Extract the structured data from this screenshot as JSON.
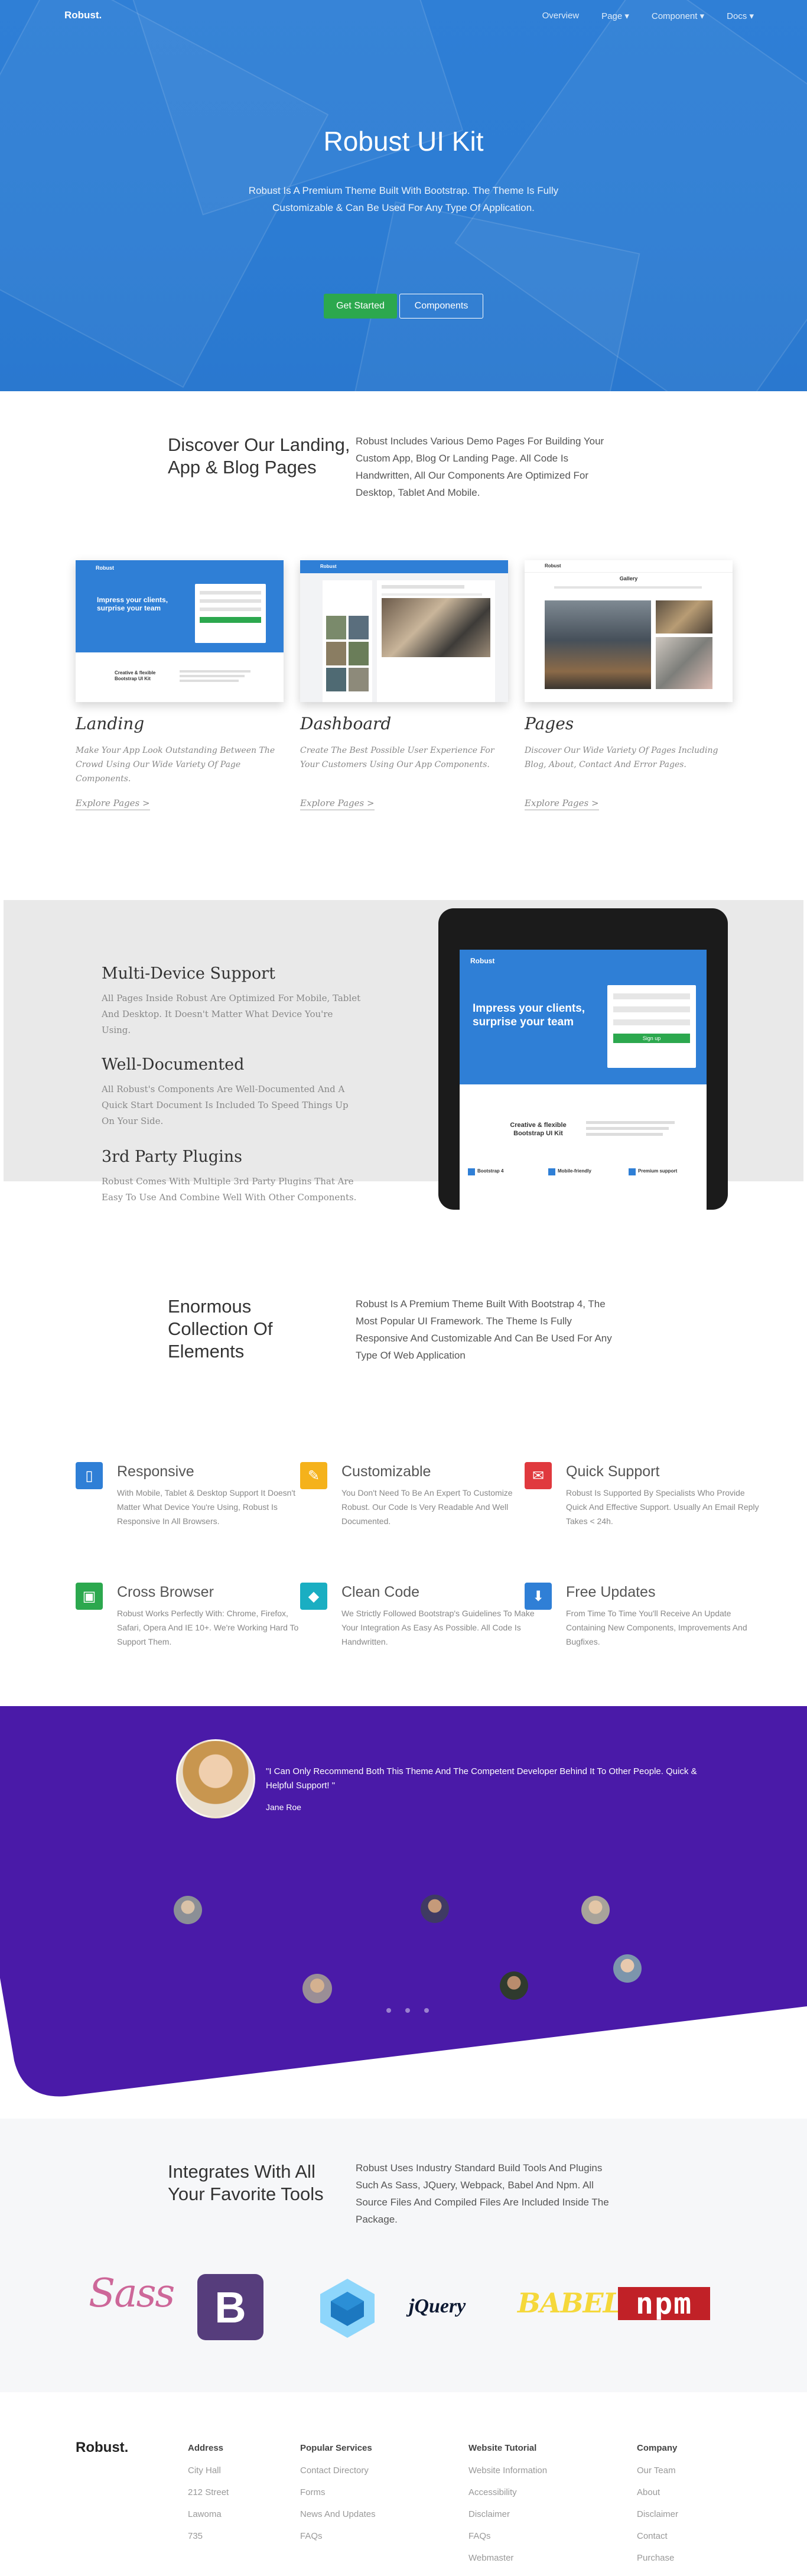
{
  "nav": {
    "brand": "Robust.",
    "links": [
      "Overview",
      "Page ▾",
      "Component ▾",
      "Docs ▾"
    ]
  },
  "hero": {
    "title": "Robust UI Kit",
    "subtitle": "Robust Is A Premium Theme Built With Bootstrap. The Theme Is Fully Customizable & Can Be Used For Any Type Of Application.",
    "primary_button": "Get Started",
    "secondary_button": "Components"
  },
  "discover": {
    "title": "Discover Our Landing, App & Blog Pages",
    "description": "Robust Includes Various Demo Pages For Building Your Custom App, Blog Or Landing Page. All Code Is Handwritten, All Our Components Are Optimized For Desktop, Tablet And Mobile."
  },
  "demos": [
    {
      "title": "Landing",
      "description": "Make Your App Look Outstanding Between The Crowd Using Our Wide Variety Of Page Components.",
      "link": "Explore Pages >",
      "thumb_brand": "Robust",
      "thumb_heading": "Impress your clients, surprise your team",
      "thumb_sub": "Creative & flexible Bootstrap UI Kit"
    },
    {
      "title": "Dashboard",
      "description": "Create The Best Possible User Experience For Your Customers Using Our App Components.",
      "link": "Explore Pages >",
      "thumb_brand": "Robust"
    },
    {
      "title": "Pages",
      "description": "Discover Our Wide Variety Of Pages Including Blog, About, Contact And Error Pages.",
      "link": "Explore Pages >",
      "thumb_brand": "Robust",
      "thumb_heading": "Gallery"
    }
  ],
  "devices": {
    "features": [
      {
        "title": "Multi-Device Support",
        "text": "All Pages Inside Robust Are Optimized For Mobile, Tablet And Desktop. It Doesn't Matter What Device You're Using."
      },
      {
        "title": "Well-Documented",
        "text": "All Robust's Components Are Well-Documented And A Quick Start Document Is Included To Speed Things Up On Your Side."
      },
      {
        "title": "3rd Party Plugins",
        "text": "Robust Comes With Multiple 3rd Party Plugins That Are Easy To Use And Combine Well With Other Components."
      }
    ],
    "tablet": {
      "brand": "Robust",
      "heading": "Impress your clients, surprise your team",
      "subheading": "Creative & flexible Bootstrap UI Kit",
      "signup": "Sign up",
      "items": [
        "Bootstrap 4",
        "Mobile-friendly",
        "Premium support"
      ]
    }
  },
  "elements": {
    "title": "Enormous Collection Of Elements",
    "description": "Robust Is A Premium Theme Built With Bootstrap 4, The Most Popular UI Framework. The Theme Is Fully Responsive And Customizable And Can Be Used For Any Type Of Web Application",
    "items": [
      {
        "icon": "mobile-icon",
        "color": "#2f7fd6",
        "title": "Responsive",
        "text": "With Mobile, Tablet & Desktop Support It Doesn't Matter What Device You're Using, Robust Is Responsive In All Browsers."
      },
      {
        "icon": "brush-icon",
        "color": "#f5b21b",
        "title": "Customizable",
        "text": "You Don't Need To Be An Expert To Customize Robust. Our Code Is Very Readable And Well Documented."
      },
      {
        "icon": "chat-icon",
        "color": "#e0393e",
        "title": "Quick Support",
        "text": "Robust Is Supported By Specialists Who Provide Quick And Effective Support. Usually An Email Reply Takes < 24h."
      },
      {
        "icon": "browser-icon",
        "color": "#2ca84e",
        "title": "Cross Browser",
        "text": "Robust Works Perfectly With: Chrome, Firefox, Safari, Opera And IE 10+. We're Working Hard To Support Them."
      },
      {
        "icon": "diamond-icon",
        "color": "#1aaec2",
        "title": "Clean Code",
        "text": "We Strictly Followed Bootstrap's Guidelines To Make Your Integration As Easy As Possible. All Code Is Handwritten."
      },
      {
        "icon": "download-icon",
        "color": "#2f7fd6",
        "title": "Free Updates",
        "text": "From Time To Time You'll Receive An Update Containing New Components, Improvements And Bugfixes."
      }
    ]
  },
  "testimonial": {
    "quote": "\"I Can Only Recommend Both This Theme And The Competent Developer Behind It To Other People. Quick & Helpful Support! \"",
    "author": "Jane Roe",
    "background": "#4a1aa8"
  },
  "integrations": {
    "title": "Integrates With All Your Favorite Tools",
    "description": "Robust Uses Industry Standard Build Tools And Plugins Such As Sass, JQuery, Webpack, Babel And Npm. All Source Files And Compiled Files Are Included Inside The Package.",
    "logos": {
      "sass": "Sass",
      "bootstrap": "B",
      "jquery": "jQuery",
      "babel": "BABEL",
      "npm": "npm"
    }
  },
  "footer": {
    "brand": "Robust.",
    "columns": [
      {
        "title": "Address",
        "items": [
          "City Hall",
          "212 Street",
          "Lawoma",
          "735"
        ]
      },
      {
        "title": "Popular Services",
        "items": [
          "Contact Directory",
          "Forms",
          "News And Updates",
          "FAQs"
        ]
      },
      {
        "title": "Website Tutorial",
        "items": [
          "Website Information",
          "Accessibility",
          "Disclaimer",
          "FAQs",
          "Webmaster"
        ]
      },
      {
        "title": "Company",
        "items": [
          "Our Team",
          "About",
          "Disclaimer",
          "Contact",
          "Purchase"
        ]
      }
    ]
  }
}
